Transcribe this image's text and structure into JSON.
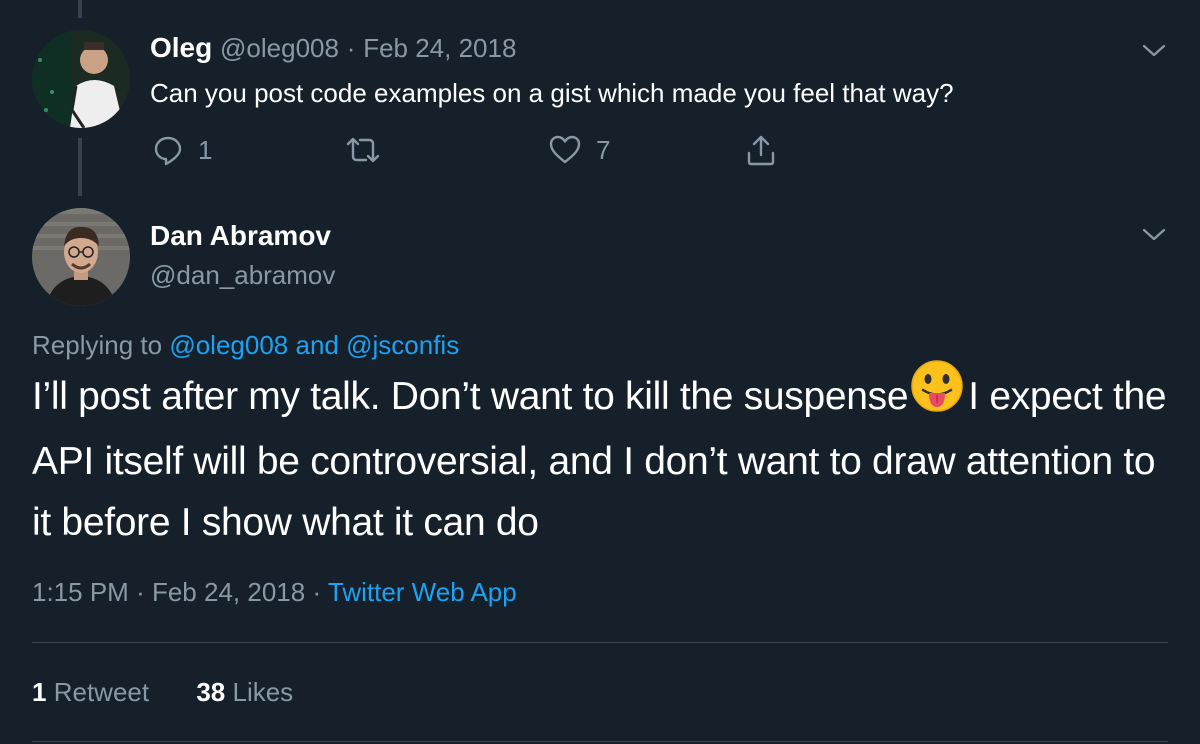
{
  "reply_tweet": {
    "author_name": "Oleg",
    "author_handle": "@oleg008",
    "separator": "·",
    "date": "Feb 24, 2018",
    "text": "Can you post code examples on a gist which made you feel that way?",
    "actions": {
      "reply_count": "1",
      "retweet_count": "",
      "like_count": "7"
    }
  },
  "main_tweet": {
    "author_name": "Dan Abramov",
    "author_handle": "@dan_abramov",
    "replying_to_prefix": "Replying to",
    "replying_to_user1": "@oleg008",
    "replying_to_and": "and",
    "replying_to_user2": "@jsconfis",
    "text_part1": "I’ll post after my talk. Don’t want to kill the suspense",
    "emoji": "face-with-tongue",
    "text_part2": "I expect the API itself will be controversial, and I don’t want to draw attention to it before I show what it can do",
    "time": "1:15 PM",
    "separator": "·",
    "date": "Feb 24, 2018",
    "source": "Twitter Web App",
    "stats": {
      "retweets_count": "1",
      "retweets_label": "Retweet",
      "likes_count": "38",
      "likes_label": "Likes"
    }
  },
  "colors": {
    "background": "#15202b",
    "muted": "#8899a6",
    "accent": "#1da1f2",
    "divider": "#38444d"
  }
}
